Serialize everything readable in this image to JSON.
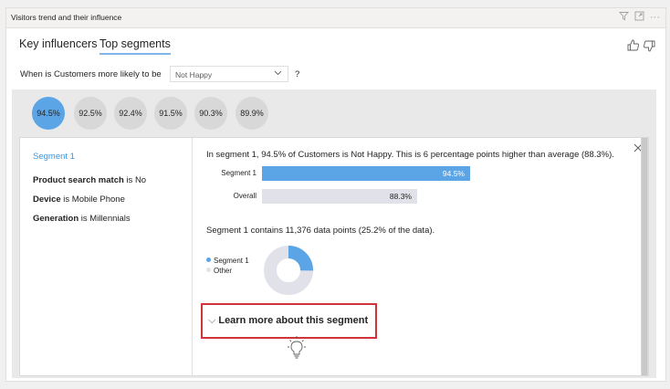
{
  "header": {
    "title": "Visitors trend and their influence"
  },
  "tabs": [
    {
      "label": "Key influencers",
      "active": false
    },
    {
      "label": "Top segments",
      "active": true
    }
  ],
  "question": {
    "prefix": "When is Customers more likely to be",
    "selected": "Not Happy",
    "suffix": "?"
  },
  "segments": [
    "94.5%",
    "92.5%",
    "92.4%",
    "91.5%",
    "90.3%",
    "89.9%"
  ],
  "detail": {
    "segment_name": "Segment 1",
    "attributes": [
      {
        "field": "Product search match",
        "value": "is No"
      },
      {
        "field": "Device",
        "value": " is Mobile Phone"
      },
      {
        "field": "Generation",
        "value": "is Millennials"
      }
    ],
    "summary": "In segment 1, 94.5% of Customers is Not Happy. This is 6 percentage points higher than average (88.3%).",
    "bars": [
      {
        "label": "Segment 1",
        "value_text": "94.5%",
        "value": 94.5,
        "color": "#5ba4e6",
        "text_color": "#ffffff"
      },
      {
        "label": "Overall",
        "value_text": "88.3%",
        "value": 88.3,
        "color": "#e1e1ea",
        "text_color": "#252423"
      }
    ],
    "points_text": "Segment 1 contains 11,376 data points (25.2% of the data).",
    "legend": [
      {
        "label": "Segment 1",
        "color": "#5ba4e6"
      },
      {
        "label": "Other",
        "color": "#e1e1ea"
      }
    ],
    "share_fraction": 0.252,
    "learn_more": "Learn more about this segment"
  },
  "icons": {
    "filter": "filter-icon",
    "focus": "focus-mode-icon",
    "more": "more-options-icon",
    "like": "thumbs-up-icon",
    "dislike": "thumbs-down-icon",
    "close": "close-icon",
    "chevron": "chevron-down-icon",
    "bulb": "lightbulb-icon"
  }
}
